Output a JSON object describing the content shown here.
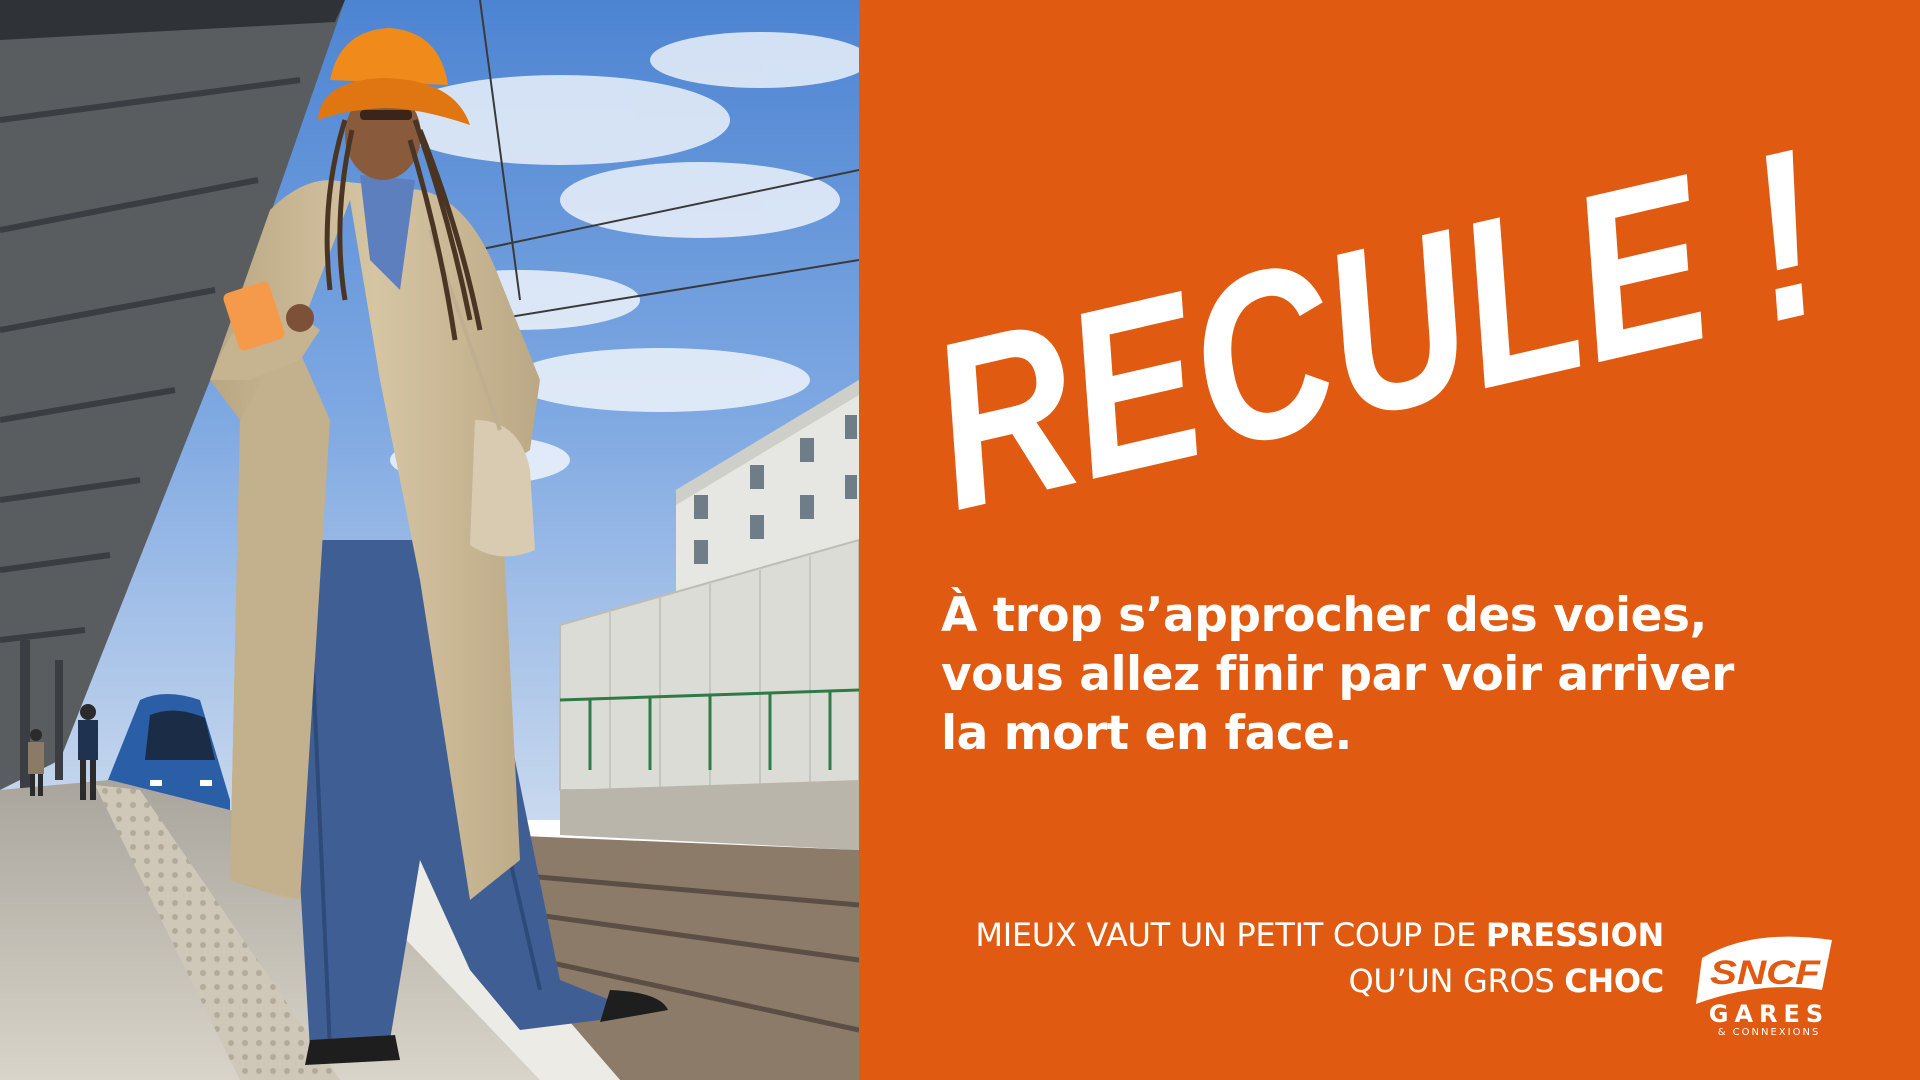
{
  "poster": {
    "headline": "RECULE !",
    "body_lines": [
      "À trop s’approcher des voies,",
      "vous allez finir par voir arriver",
      "la mort en face."
    ],
    "tagline": {
      "line1_regular": "MIEUX VAUT UN PETIT COUP DE ",
      "line1_bold": "PRESSION",
      "line2_regular": "QU’UN GROS ",
      "line2_bold": "CHOC"
    },
    "logo": {
      "brand": "SNCF",
      "line1": "GARES",
      "line2": "& CONNEXIONS"
    }
  },
  "colors": {
    "panel_orange": "#e05a12",
    "text_white": "#ffffff",
    "sky_blue": "#5b8fd6",
    "coat_beige": "#cdbb98",
    "jeans_blue": "#3f5f94",
    "hat_orange": "#f08a1a",
    "train_blue": "#2a5fa8"
  },
  "photo": {
    "icons": [
      "station-canopy",
      "woman-figure",
      "orange-bucket-hat",
      "smartphone",
      "regional-train",
      "building",
      "railway-tracks",
      "platform"
    ]
  }
}
